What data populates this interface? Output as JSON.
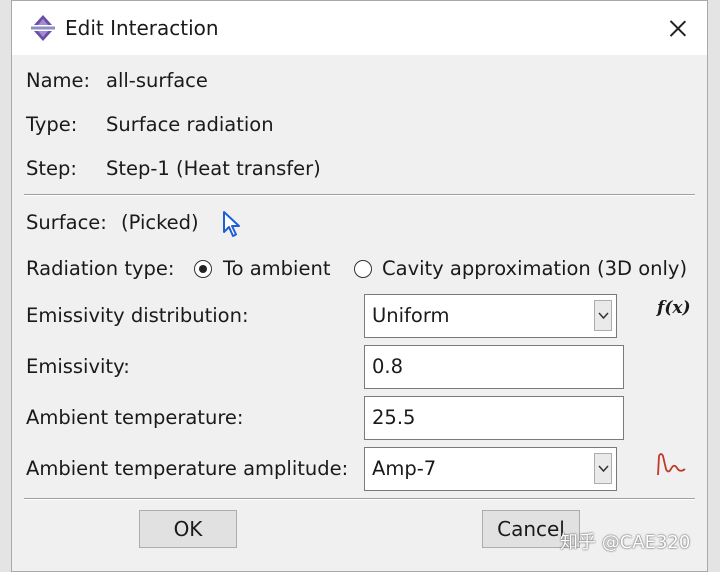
{
  "dialog": {
    "title": "Edit Interaction"
  },
  "info": {
    "name_label": "Name:",
    "name_value": "all-surface",
    "type_label": "Type:",
    "type_value": "Surface radiation",
    "step_label": "Step:",
    "step_value": "Step-1 (Heat transfer)"
  },
  "surface": {
    "label": "Surface:",
    "value": "(Picked)"
  },
  "radiation_type": {
    "label": "Radiation type:",
    "options": [
      {
        "label": "To ambient",
        "selected": true
      },
      {
        "label": "Cavity approximation (3D only)",
        "selected": false
      }
    ]
  },
  "fields": {
    "emissivity_distribution": {
      "label": "Emissivity distribution:",
      "value": "Uniform"
    },
    "emissivity": {
      "label": "Emissivity:",
      "value": "0.8"
    },
    "ambient_temperature": {
      "label": "Ambient temperature:",
      "value": "25.5"
    },
    "ambient_temperature_amplitude": {
      "label": "Ambient temperature amplitude:",
      "value": "Amp-7"
    }
  },
  "icons": {
    "function": "f(x)",
    "amplitude": "amplitude-wave-icon",
    "select": "arrow-cursor-icon"
  },
  "buttons": {
    "ok": "OK",
    "cancel": "Cancel"
  },
  "watermark": "知乎 @CAE320",
  "colors": {
    "accent": "#1f5fd6",
    "amplitude": "#c0392b"
  }
}
